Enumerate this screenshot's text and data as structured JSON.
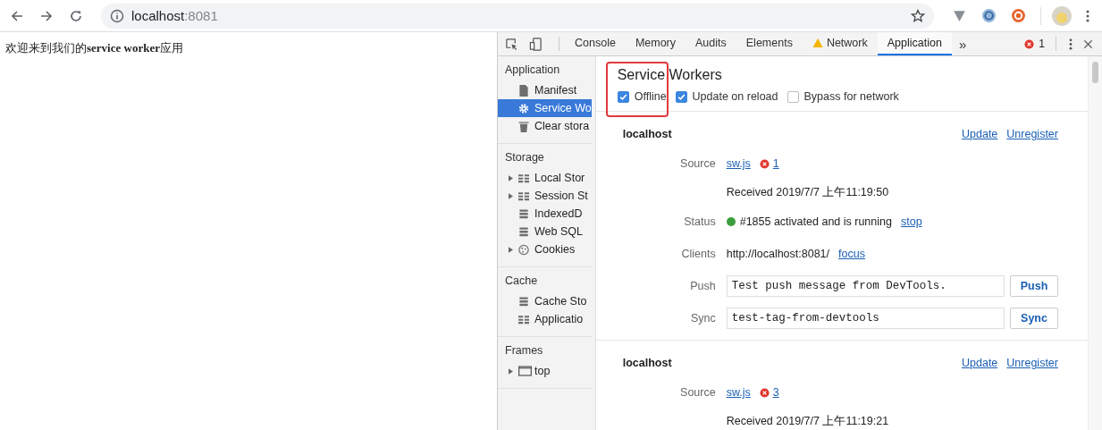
{
  "browser": {
    "url_host": "localhost",
    "url_port": ":8081"
  },
  "page": {
    "text": "欢迎来到我们的**service worker**应用"
  },
  "devtools": {
    "tabs": [
      {
        "label": "Console",
        "warning": false,
        "selected": false
      },
      {
        "label": "Memory",
        "warning": false,
        "selected": false
      },
      {
        "label": "Audits",
        "warning": false,
        "selected": false
      },
      {
        "label": "Elements",
        "warning": false,
        "selected": false
      },
      {
        "label": "Network",
        "warning": true,
        "selected": false
      },
      {
        "label": "Application",
        "warning": false,
        "selected": true
      }
    ],
    "overflow": "»",
    "error_count": "1"
  },
  "sidebar": [
    {
      "title": "Application",
      "items": [
        {
          "label": "Manifest",
          "kind": "file",
          "expandable": false,
          "selected": false
        },
        {
          "label": "Service Wo",
          "kind": "gear",
          "expandable": false,
          "selected": true
        },
        {
          "label": "Clear stora",
          "kind": "trash",
          "expandable": false,
          "selected": false
        }
      ]
    },
    {
      "title": "Storage",
      "items": [
        {
          "label": "Local Stor",
          "kind": "grid",
          "expandable": true,
          "selected": false
        },
        {
          "label": "Session St",
          "kind": "grid",
          "expandable": true,
          "selected": false
        },
        {
          "label": "IndexedD",
          "kind": "db",
          "expandable": false,
          "selected": false
        },
        {
          "label": "Web SQL",
          "kind": "db",
          "expandable": false,
          "selected": false
        },
        {
          "label": "Cookies",
          "kind": "cookie",
          "expandable": true,
          "selected": false
        }
      ]
    },
    {
      "title": "Cache",
      "items": [
        {
          "label": "Cache Sto",
          "kind": "db",
          "expandable": false,
          "selected": false
        },
        {
          "label": "Applicatio",
          "kind": "grid",
          "expandable": false,
          "selected": false
        }
      ]
    },
    {
      "title": "Frames",
      "items": [
        {
          "label": "top",
          "kind": "frame",
          "expandable": true,
          "selected": false
        }
      ]
    }
  ],
  "main": {
    "title": "Service Workers",
    "highlighted": true,
    "options": [
      {
        "label": "Offline",
        "checked": true
      },
      {
        "label": "Update on reload",
        "checked": true
      },
      {
        "label": "Bypass for network",
        "checked": false
      }
    ],
    "workers": [
      {
        "host": "localhost",
        "actions": [
          "Update",
          "Unregister"
        ],
        "rows": [
          {
            "kind": "source",
            "label": "Source",
            "file": "sw.js",
            "errors": "1"
          },
          {
            "kind": "text",
            "label": "",
            "text": "Received 2019/7/7 上午11:19:50"
          },
          {
            "kind": "status",
            "label": "Status",
            "color": "#3c9e3f",
            "text": "#1855 activated and is running",
            "action": "stop"
          },
          {
            "kind": "clients",
            "label": "Clients",
            "text": "http://localhost:8081/",
            "action": "focus"
          },
          {
            "kind": "input",
            "label": "Push",
            "value": "Test push message from DevTools.",
            "button": "Push"
          },
          {
            "kind": "input",
            "label": "Sync",
            "value": "test-tag-from-devtools",
            "button": "Sync"
          }
        ]
      },
      {
        "host": "localhost",
        "actions": [
          "Update",
          "Unregister"
        ],
        "rows": [
          {
            "kind": "source",
            "label": "Source",
            "file": "sw.js",
            "errors": "3"
          },
          {
            "kind": "text",
            "label": "",
            "text": "Received 2019/7/7 上午11:19:21"
          }
        ]
      }
    ]
  }
}
